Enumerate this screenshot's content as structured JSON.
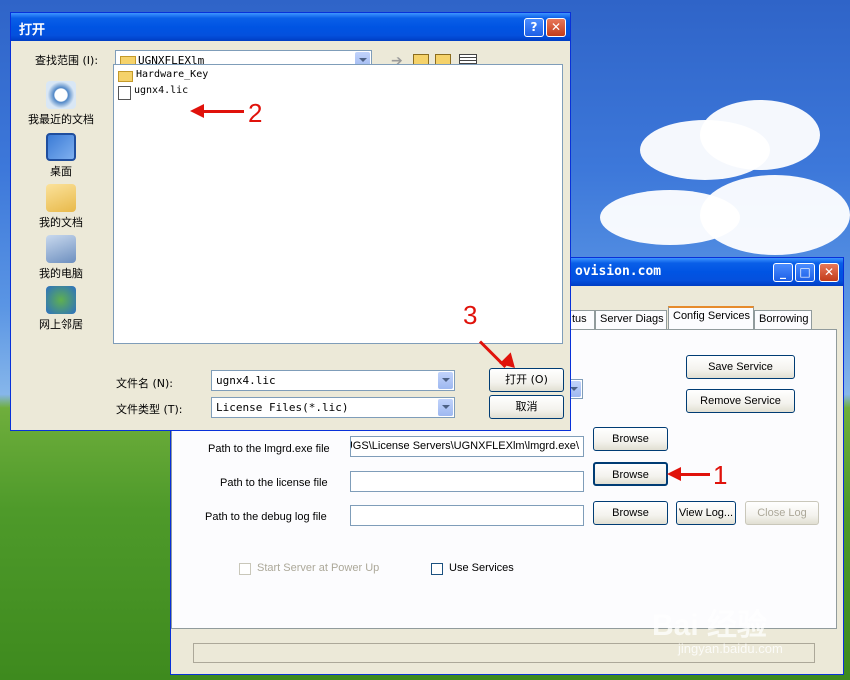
{
  "open_dialog": {
    "title": "打开",
    "help_button": "?",
    "close_button": "✕",
    "look_in_label": "查找范围 (I):",
    "look_in_value": "UGNXFLEXlm",
    "places": [
      {
        "label": "我最近的文档",
        "icon": "recent-documents-icon"
      },
      {
        "label": "桌面",
        "icon": "desktop-icon"
      },
      {
        "label": "我的文档",
        "icon": "my-documents-icon"
      },
      {
        "label": "我的电脑",
        "icon": "my-computer-icon"
      },
      {
        "label": "网上邻居",
        "icon": "network-places-icon"
      }
    ],
    "files": [
      {
        "name": "Hardware_Key",
        "icon": "folder-icon"
      },
      {
        "name": "ugnx4.lic",
        "icon": "license-file-icon"
      }
    ],
    "filename_label": "文件名 (N):",
    "filename_value": "ugnx4.lic",
    "filetype_label": "文件类型 (T):",
    "filetype_value": "License Files(*.lic)",
    "open_button": "打开 (O)",
    "cancel_button": "取消"
  },
  "lmtools": {
    "title_partial": "ovision.com",
    "tabs": [
      "tus",
      "Server Diags",
      "Config Services",
      "Borrowing"
    ],
    "active_tab": "Config Services",
    "save_service": "Save Service",
    "remove_service": "Remove Service",
    "lmgrd_label": "Path to the lmgrd.exe file",
    "lmgrd_value": "\\UGS\\License Servers\\UGNXFLEXlm\\lmgrd.exe",
    "license_label": "Path to the license file",
    "license_value": "",
    "debug_label": "Path to the debug log file",
    "debug_value": "",
    "browse": "Browse",
    "view_log": "View Log...",
    "close_log": "Close Log",
    "start_server_label": "Start Server at Power Up",
    "use_services_label": "Use Services"
  },
  "annotations": {
    "step1": "1",
    "step2": "2",
    "step3": "3"
  },
  "watermark": {
    "logo": "Bai 经验",
    "url": "jingyan.baidu.com"
  }
}
